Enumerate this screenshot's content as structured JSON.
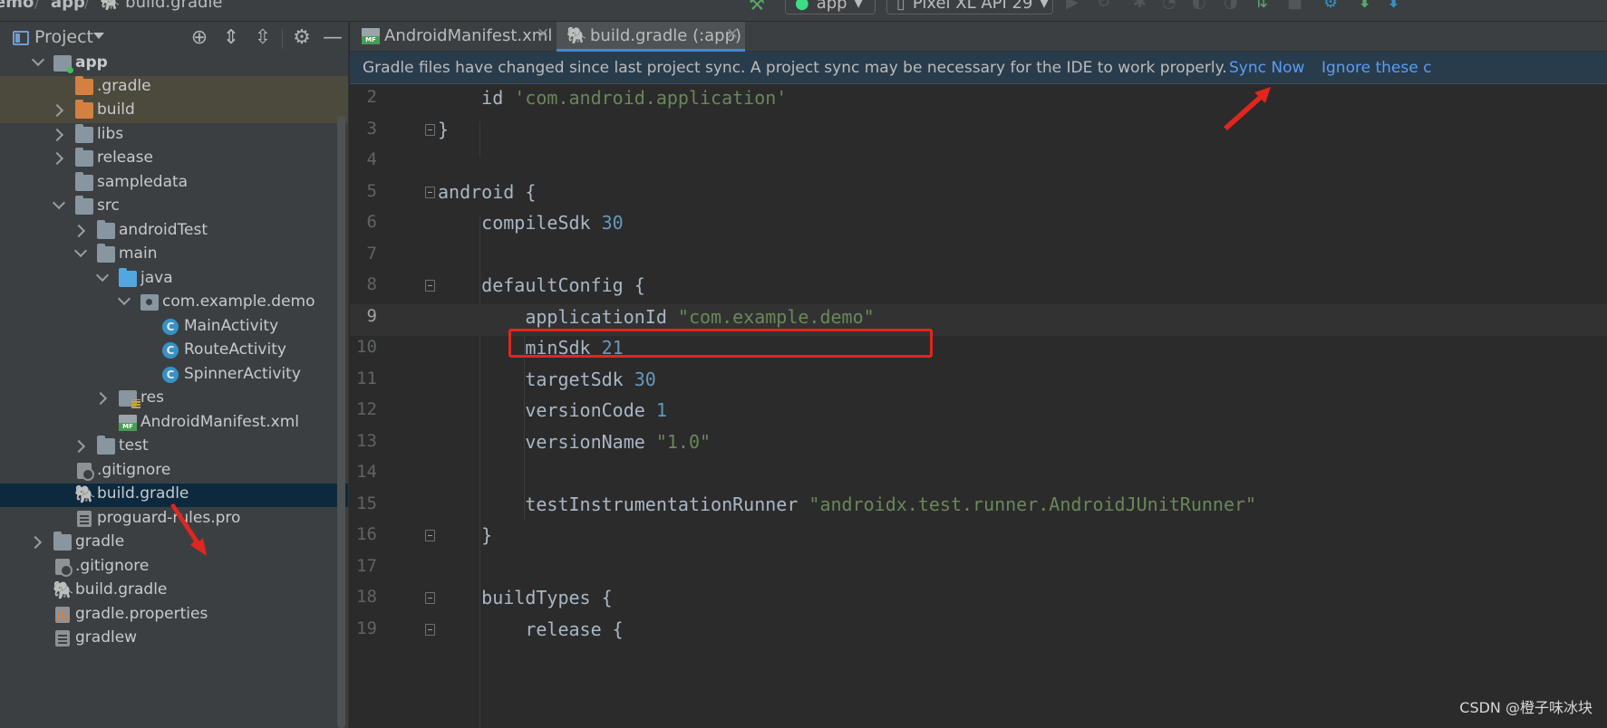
{
  "breadcrumb": [
    "emo",
    "app",
    "build.gradle"
  ],
  "toolbar": {
    "run_config": "app",
    "device": "Pixel XL API 29"
  },
  "project_panel": {
    "title": "Project",
    "items": [
      {
        "label": "app",
        "icon": "module-folder-icon",
        "expanded": true
      },
      {
        "label": ".gradle",
        "icon": "folder-icon-orange"
      },
      {
        "label": "build",
        "icon": "folder-icon-orange",
        "expanded": false
      },
      {
        "label": "libs",
        "icon": "folder-icon",
        "expanded": false
      },
      {
        "label": "release",
        "icon": "folder-icon",
        "expanded": false
      },
      {
        "label": "sampledata",
        "icon": "folder-icon"
      },
      {
        "label": "src",
        "icon": "folder-icon",
        "expanded": true
      },
      {
        "label": "androidTest",
        "icon": "folder-icon",
        "expanded": false
      },
      {
        "label": "main",
        "icon": "folder-icon",
        "expanded": true
      },
      {
        "label": "java",
        "icon": "source-folder-icon",
        "expanded": true
      },
      {
        "label": "com.example.demo",
        "icon": "package-icon",
        "expanded": true
      },
      {
        "label": "MainActivity",
        "icon": "class-icon"
      },
      {
        "label": "RouteActivity",
        "icon": "class-icon"
      },
      {
        "label": "SpinnerActivity",
        "icon": "class-icon"
      },
      {
        "label": "res",
        "icon": "res-folder-icon",
        "expanded": false
      },
      {
        "label": "AndroidManifest.xml",
        "icon": "manifest-icon"
      },
      {
        "label": "test",
        "icon": "folder-icon",
        "expanded": false
      },
      {
        "label": ".gitignore",
        "icon": "gitignore-icon"
      },
      {
        "label": "build.gradle",
        "icon": "gradle-icon",
        "selected": true
      },
      {
        "label": "proguard-rules.pro",
        "icon": "file-icon"
      },
      {
        "label": "gradle",
        "icon": "folder-icon",
        "expanded": false
      },
      {
        "label": ".gitignore",
        "icon": "gitignore-icon"
      },
      {
        "label": "build.gradle",
        "icon": "gradle-icon"
      },
      {
        "label": "gradle.properties",
        "icon": "properties-icon"
      },
      {
        "label": "gradlew",
        "icon": "file-icon"
      }
    ]
  },
  "tabs": [
    {
      "label": "AndroidManifest.xml",
      "active": false
    },
    {
      "label": "build.gradle (:app)",
      "active": true
    }
  ],
  "banner": {
    "message": "Gradle files have changed since last project sync. A project sync may be necessary for the IDE to work properly.",
    "sync_now": "Sync Now",
    "ignore": "Ignore these c"
  },
  "code_lines": [
    {
      "n": "2",
      "text": "    id 'com.android.application'"
    },
    {
      "n": "3",
      "text": "}"
    },
    {
      "n": "4",
      "text": ""
    },
    {
      "n": "5",
      "text": "android {"
    },
    {
      "n": "6",
      "text": "    compileSdk 30"
    },
    {
      "n": "7",
      "text": ""
    },
    {
      "n": "8",
      "text": "    defaultConfig {"
    },
    {
      "n": "9",
      "text": "        applicationId \"com.example.demo\""
    },
    {
      "n": "10",
      "text": "        minSdk 21"
    },
    {
      "n": "11",
      "text": "        targetSdk 30"
    },
    {
      "n": "12",
      "text": "        versionCode 1"
    },
    {
      "n": "13",
      "text": "        versionName \"1.0\""
    },
    {
      "n": "14",
      "text": ""
    },
    {
      "n": "15",
      "text": "        testInstrumentationRunner \"androidx.test.runner.AndroidJUnitRunner\""
    },
    {
      "n": "16",
      "text": "    }"
    },
    {
      "n": "17",
      "text": ""
    },
    {
      "n": "18",
      "text": "    buildTypes {"
    },
    {
      "n": "19",
      "text": "        release {"
    }
  ],
  "watermark": "CSDN @橙子味冰块",
  "colors": {
    "keyword": "#cc7832",
    "string": "#6a8759",
    "number": "#6897bb",
    "identifier": "#a9b7c6",
    "highlight_box": "#e0261e",
    "link": "#589df6"
  }
}
